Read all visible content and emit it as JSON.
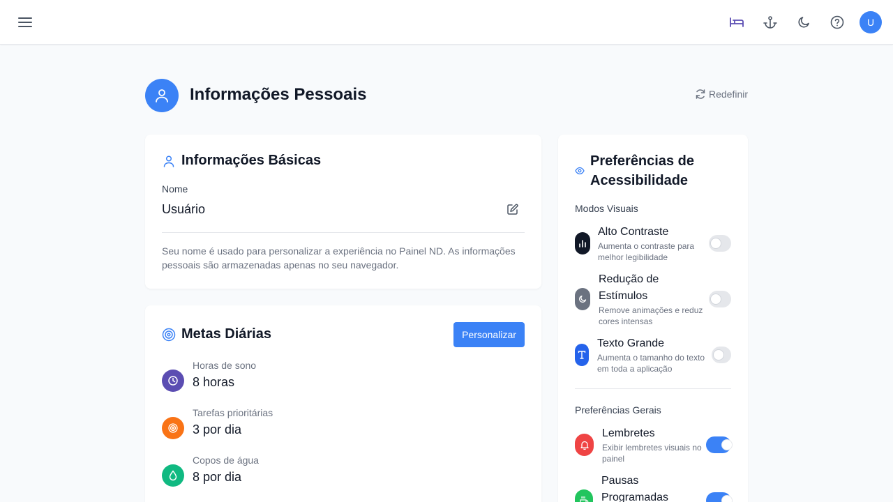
{
  "header": {
    "icons": [
      "menu-icon",
      "bed-icon",
      "anchor-icon",
      "moon-icon",
      "help-icon"
    ],
    "avatar_initial": "U"
  },
  "page": {
    "title": "Informações Pessoais",
    "reset_label": "Redefinir"
  },
  "basic_info": {
    "title": "Informações Básicas",
    "name_label": "Nome",
    "name_value": "Usuário",
    "help_text": "Seu nome é usado para personalizar a experiência no Painel ND. As informações pessoais são armazenadas apenas no seu navegador."
  },
  "goals": {
    "title": "Metas Diárias",
    "customize_label": "Personalizar",
    "items": [
      {
        "label": "Horas de sono",
        "value": "8 horas",
        "icon": "clock-icon",
        "color": "#5b4db2"
      },
      {
        "label": "Tarefas prioritárias",
        "value": "3 por dia",
        "icon": "target-icon",
        "color": "#f97316"
      },
      {
        "label": "Copos de água",
        "value": "8 por dia",
        "icon": "droplet-icon",
        "color": "#10b981"
      }
    ]
  },
  "accessibility": {
    "title_line1": "Preferências de",
    "title_line2": "Acessibilidade",
    "visual_modes_label": "Modos Visuais",
    "general_label": "Preferências Gerais",
    "visual_modes": [
      {
        "title": "Alto Contraste",
        "desc_line1": "Aumenta o contraste para",
        "desc_line2": "melhor legibilidade",
        "enabled": false,
        "icon": "bar-chart-icon",
        "color": "#111827"
      },
      {
        "title_line1": "Redução de",
        "title_line2": "Estímulos",
        "desc_line1": "Remove animações e reduz",
        "desc_line2": "cores intensas",
        "enabled": false,
        "icon": "moon-icon",
        "color": "#6b7280"
      },
      {
        "title": "Texto Grande",
        "desc_line1": "Aumenta o tamanho do texto",
        "desc_line2": "em toda a aplicação",
        "enabled": false,
        "icon": "type-icon",
        "color": "#2563eb"
      }
    ],
    "general": [
      {
        "title": "Lembretes",
        "desc_line1": "Exibir lembretes visuais no",
        "desc_line2": "painel",
        "enabled": true,
        "icon": "bell-icon",
        "color": "#ef4444"
      },
      {
        "title_line1": "Pausas",
        "title_line2": "Programadas",
        "enabled": true,
        "icon": "coffee-icon",
        "color": "#22c55e"
      }
    ]
  },
  "colors": {
    "accent": "#3b82f6",
    "background": "#f8fafc"
  }
}
